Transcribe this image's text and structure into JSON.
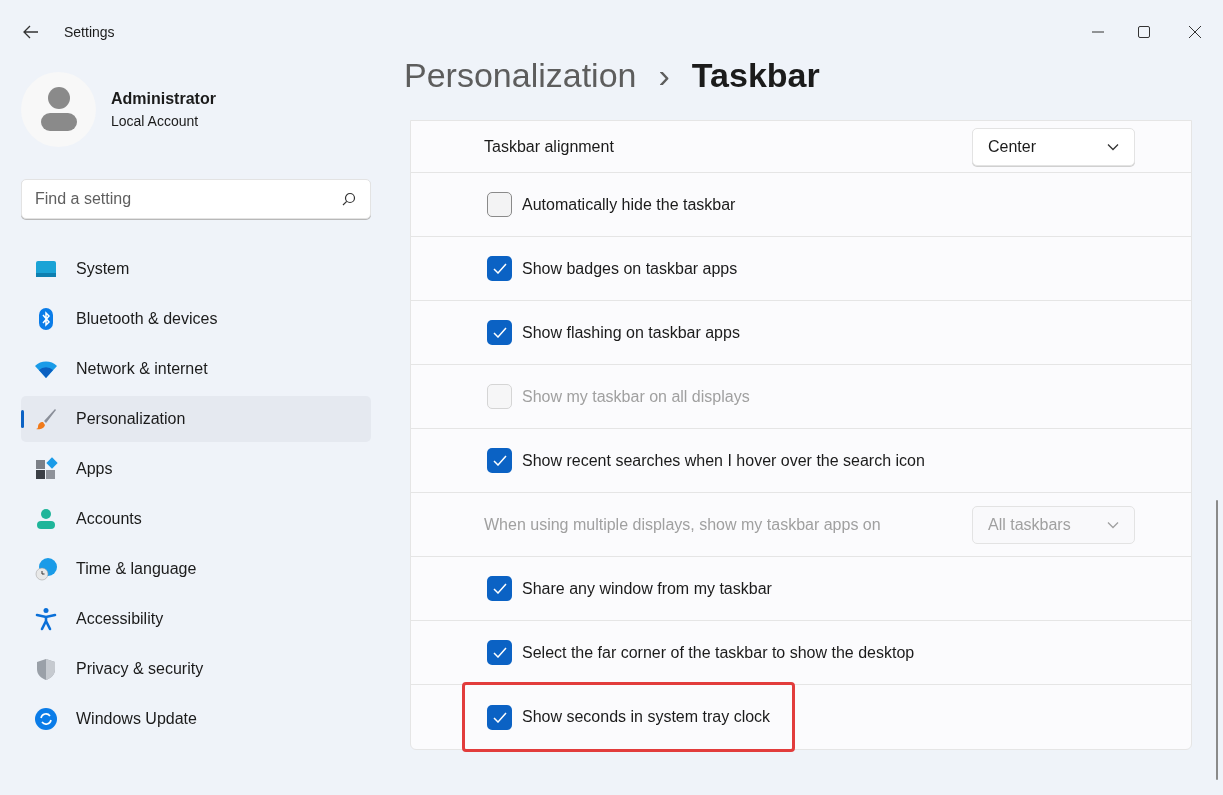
{
  "window": {
    "title": "Settings"
  },
  "account": {
    "name": "Administrator",
    "type": "Local Account"
  },
  "search": {
    "placeholder": "Find a setting"
  },
  "sidebar": {
    "items": [
      {
        "label": "System",
        "selected": false
      },
      {
        "label": "Bluetooth & devices",
        "selected": false
      },
      {
        "label": "Network & internet",
        "selected": false
      },
      {
        "label": "Personalization",
        "selected": true
      },
      {
        "label": "Apps",
        "selected": false
      },
      {
        "label": "Accounts",
        "selected": false
      },
      {
        "label": "Time & language",
        "selected": false
      },
      {
        "label": "Accessibility",
        "selected": false
      },
      {
        "label": "Privacy & security",
        "selected": false
      },
      {
        "label": "Windows Update",
        "selected": false
      }
    ]
  },
  "breadcrumb": {
    "parent": "Personalization",
    "separator": "›",
    "current": "Taskbar"
  },
  "settings": [
    {
      "kind": "dropdown",
      "label": "Taskbar alignment",
      "value": "Center",
      "disabled": false
    },
    {
      "kind": "checkbox",
      "label": "Automatically hide the taskbar",
      "checked": false,
      "disabled": false
    },
    {
      "kind": "checkbox",
      "label": "Show badges on taskbar apps",
      "checked": true,
      "disabled": false
    },
    {
      "kind": "checkbox",
      "label": "Show flashing on taskbar apps",
      "checked": true,
      "disabled": false
    },
    {
      "kind": "checkbox",
      "label": "Show my taskbar on all displays",
      "checked": false,
      "disabled": true
    },
    {
      "kind": "checkbox",
      "label": "Show recent searches when I hover over the search icon",
      "checked": true,
      "disabled": false
    },
    {
      "kind": "dropdown",
      "label": "When using multiple displays, show my taskbar apps on",
      "value": "All taskbars",
      "disabled": true
    },
    {
      "kind": "checkbox",
      "label": "Share any window from my taskbar",
      "checked": true,
      "disabled": false
    },
    {
      "kind": "checkbox",
      "label": "Select the far corner of the taskbar to show the desktop",
      "checked": true,
      "disabled": false
    },
    {
      "kind": "checkbox",
      "label": "Show seconds in system tray clock",
      "checked": true,
      "disabled": false,
      "highlighted": true
    }
  ]
}
